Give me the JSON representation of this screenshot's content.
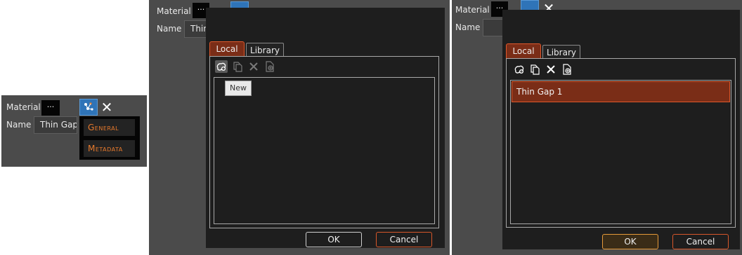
{
  "panel1": {
    "material_label": "Material",
    "material_button": "···",
    "name_label": "Name",
    "name_value": "Thin Gap",
    "menu_items": [
      "General",
      "Metadata"
    ]
  },
  "panel2": {
    "material_label": "Material",
    "material_button": "···",
    "name_label": "Name",
    "name_value": "Thin",
    "tabs": [
      "Local",
      "Library"
    ],
    "toolbar_icons": [
      "new-material-icon",
      "copy-icon",
      "delete-icon",
      "import-icon"
    ],
    "tooltip": "New",
    "ok_label": "OK",
    "cancel_label": "Cancel"
  },
  "panel3": {
    "material_label": "Material",
    "material_button": "···",
    "name_label": "Name",
    "tabs": [
      "Local",
      "Library"
    ],
    "toolbar_icons": [
      "new-material-icon",
      "copy-icon",
      "delete-icon",
      "import-icon"
    ],
    "list_items": [
      "Thin Gap 1"
    ],
    "ok_label": "OK",
    "cancel_label": "Cancel"
  },
  "colors": {
    "panel_bg": "#4b4b4b",
    "dialog_bg": "#1e1e1e",
    "accent_orange": "#e0592c",
    "tab_active_bg": "#7a2d17",
    "tool_blue": "#2f74b8"
  }
}
